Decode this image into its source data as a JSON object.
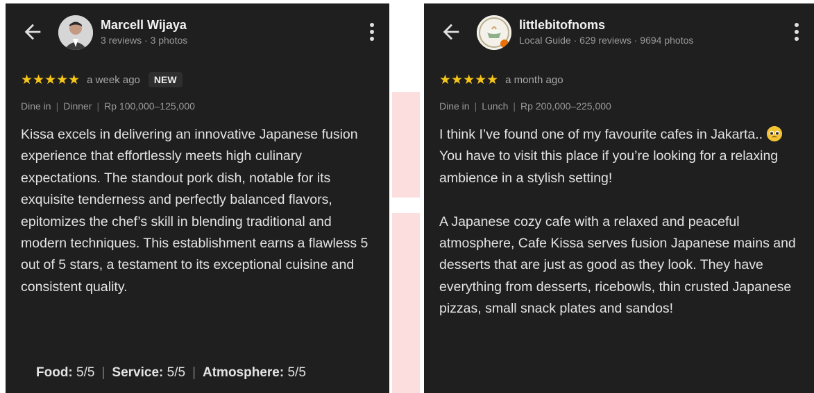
{
  "left_review": {
    "user": {
      "name": "Marcell Wijaya",
      "meta": "3 reviews · 3 photos"
    },
    "stars": "★★★★★",
    "when": "a week ago",
    "badge": "NEW",
    "tags": [
      "Dine in",
      "Dinner",
      "Rp 100,000–125,000"
    ],
    "text": "Kissa excels in delivering an innovative Japanese fusion experience that effortlessly meets high culinary expectations. The standout pork dish, notable for its exquisite tenderness and perfectly balanced flavors, epitomizes the chef’s skill in blending traditional and modern techniques. This establishment earns a flawless 5 out of 5 stars, a testament to its exceptional cuisine and consistent quality.",
    "scores": [
      {
        "label": "Food:",
        "value": "5/5"
      },
      {
        "label": "Service:",
        "value": "5/5"
      },
      {
        "label": "Atmosphere:",
        "value": "5/5"
      }
    ]
  },
  "right_review": {
    "user": {
      "name": "littlebitofnoms",
      "meta": "Local Guide · 629 reviews · 9694 photos"
    },
    "stars": "★★★★★",
    "when": "a month ago",
    "tags": [
      "Dine in",
      "Lunch",
      "Rp 200,000–225,000"
    ],
    "text_p1_before": "I think I’ve found one of my favourite cafes in Jakarta.. ",
    "emoji_name": "pleading-face-emoji",
    "text_p1_after": " You have to visit this place if you’re looking for a relaxing ambience in a stylish setting!",
    "text_p2": "A Japanese cozy cafe with a relaxed and peaceful atmosphere, Cafe Kissa serves fusion Japanese mains and desserts that are just as good as they look. They have everything from desserts, ricebowls, thin crusted Japanese pizzas, small snack plates and sandos!"
  },
  "colors": {
    "card_bg": "#1f1f1f",
    "star": "#f5c518",
    "accent_strip": "#fcdede"
  }
}
